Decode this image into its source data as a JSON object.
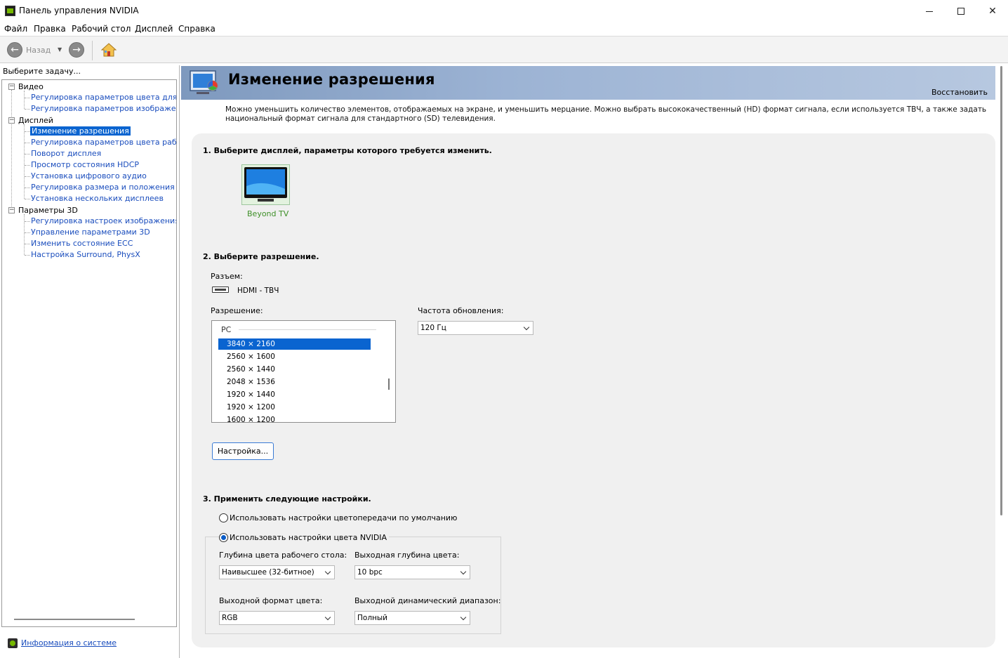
{
  "window": {
    "title": "Панель управления NVIDIA"
  },
  "menu": [
    "Файл",
    "Правка",
    "Рабочий стол",
    "Дисплей",
    "Справка"
  ],
  "toolbar": {
    "back_label": "Назад"
  },
  "sidebar": {
    "prompt": "Выберите задачу...",
    "groups": [
      {
        "label": "Видео",
        "items": [
          "Регулировка параметров цвета для вид",
          "Регулировка параметров изображения д"
        ]
      },
      {
        "label": "Дисплей",
        "items": [
          "Изменение разрешения",
          "Регулировка параметров цвета рабочег",
          "Поворот дисплея",
          "Просмотр состояния HDCP",
          "Установка цифрового аудио",
          "Регулировка размера и положения рабо",
          "Установка нескольких дисплеев"
        ]
      },
      {
        "label": "Параметры 3D",
        "items": [
          "Регулировка настроек изображения с пр",
          "Управление параметрами 3D",
          "Изменить состояние ECC",
          "Настройка Surround, PhysX"
        ]
      }
    ],
    "selected": "Изменение разрешения",
    "system_info_link": "Информация о системе"
  },
  "page": {
    "title": "Изменение разрешения",
    "restore": "Восстановить",
    "description": "Можно уменьшить количество элементов, отображаемых на экране, и уменьшить мерцание. Можно выбрать высококачественный (HD) формат сигнала, если используется ТВЧ, а также задать национальный формат сигнала для стандартного (SD) телевидения.",
    "section1": {
      "title": "1. Выберите дисплей, параметры которого требуется изменить.",
      "display_name": "Beyond TV"
    },
    "section2": {
      "title": "2. Выберите разрешение.",
      "connector_label": "Разъем:",
      "connector_value": "HDMI - ТВЧ",
      "resolution_label": "Разрешение:",
      "resolution_group": "PC",
      "resolutions": [
        "3840 × 2160",
        "2560 × 1600",
        "2560 × 1440",
        "2048 × 1536",
        "1920 × 1440",
        "1920 × 1200",
        "1600 × 1200"
      ],
      "selected_resolution": "3840 × 2160",
      "refresh_label": "Частота обновления:",
      "refresh_value": "120 Гц",
      "customize_button": "Настройка..."
    },
    "section3": {
      "title": "3. Применить следующие настройки.",
      "option_default": "Использовать настройки цветопередачи по умолчанию",
      "option_nvidia": "Использовать настройки цвета NVIDIA",
      "selected_option": "nvidia",
      "desktop_depth_label": "Глубина цвета рабочего стола:",
      "desktop_depth_value": "Наивысшее (32-битное)",
      "output_depth_label": "Выходная глубина цвета:",
      "output_depth_value": "10 bpc",
      "output_format_label": "Выходной формат цвета:",
      "output_format_value": "RGB",
      "dynamic_range_label": "Выходной динамический диапазон:",
      "dynamic_range_value": "Полный"
    }
  },
  "colors": {
    "accent": "#0a64d0",
    "link": "#1a4dbd",
    "nvidia_green": "#76b900",
    "header_band": "#9cb3d4"
  }
}
